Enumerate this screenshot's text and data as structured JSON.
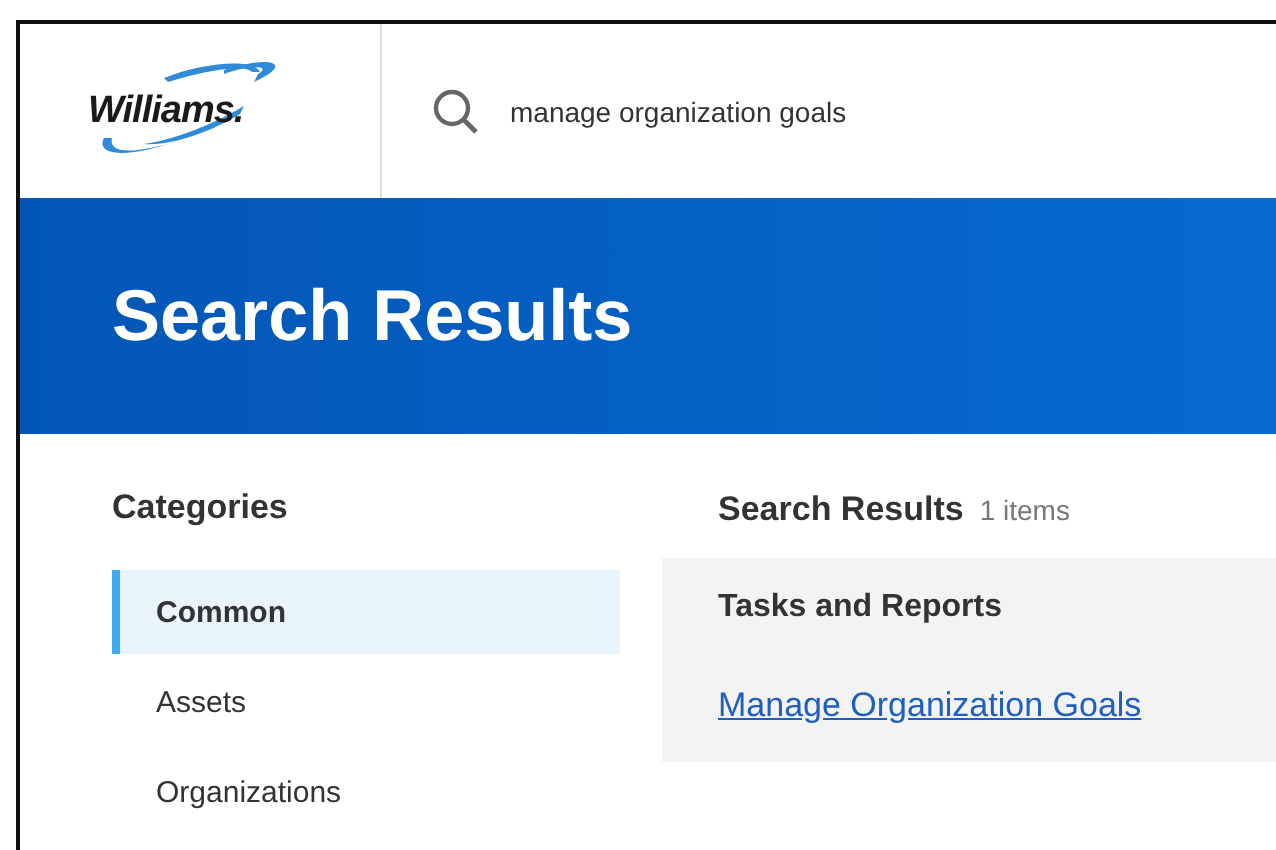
{
  "header": {
    "logo": "Williams.",
    "search": {
      "value": "manage organization goals"
    }
  },
  "banner": {
    "title": "Search Results"
  },
  "categories": {
    "heading": "Categories",
    "items": [
      {
        "label": "Common",
        "selected": true
      },
      {
        "label": "Assets",
        "selected": false
      },
      {
        "label": "Organizations",
        "selected": false
      }
    ]
  },
  "results": {
    "heading": "Search Results",
    "count": "1 items",
    "group": "Tasks and Reports",
    "links": [
      "Manage Organization Goals"
    ]
  }
}
